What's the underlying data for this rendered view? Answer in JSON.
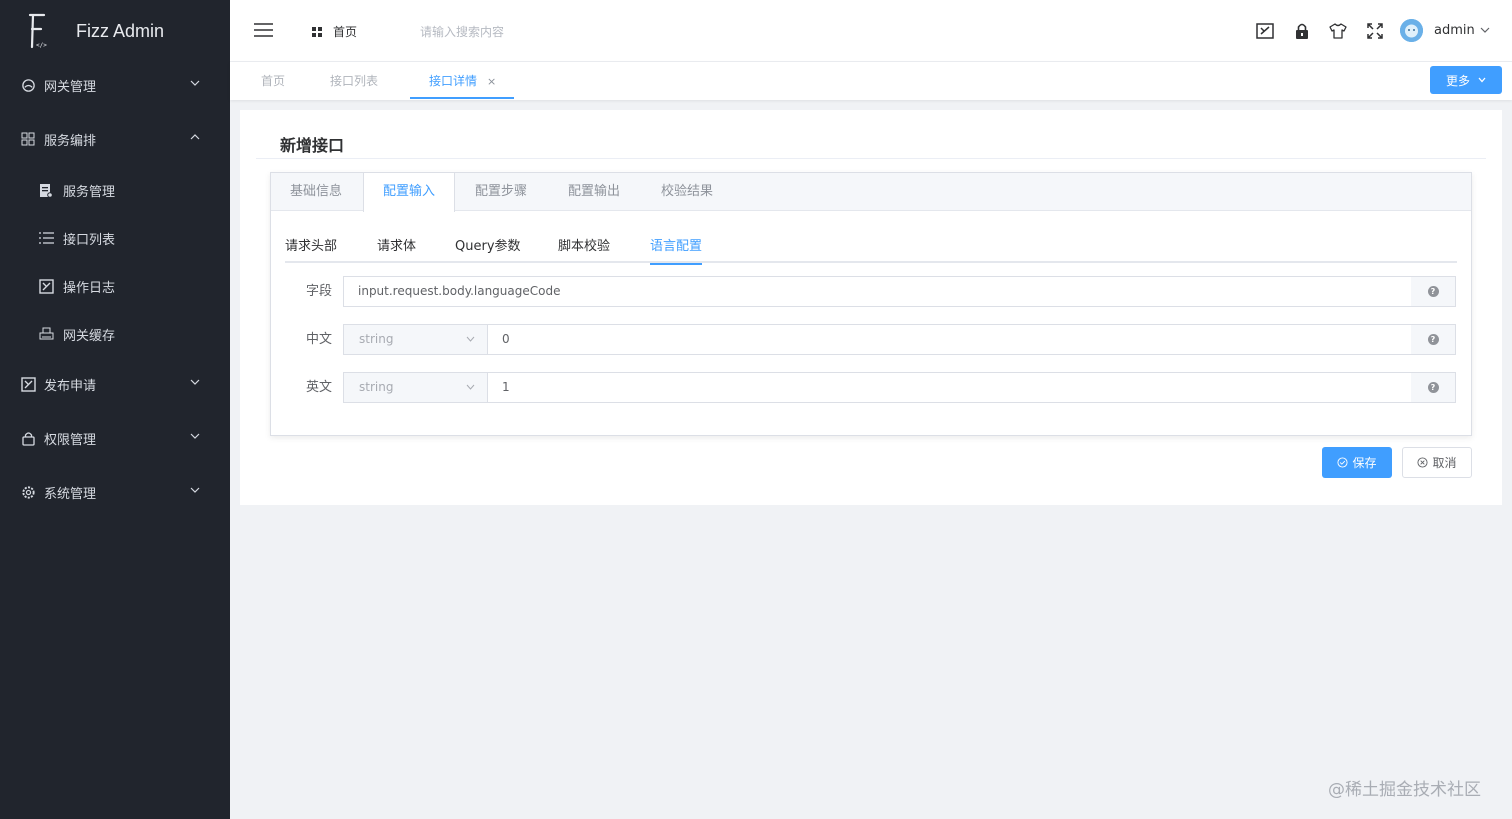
{
  "app": {
    "title": "Fizz Admin"
  },
  "sidebar": {
    "menus": [
      {
        "label": "网关管理",
        "icon": "cloud-icon"
      },
      {
        "label": "服务编排",
        "icon": "grid-icon"
      },
      {
        "label": "发布申请",
        "icon": "edit-icon"
      },
      {
        "label": "权限管理",
        "icon": "lock-icon"
      },
      {
        "label": "系统管理",
        "icon": "gear-icon"
      }
    ],
    "sub_items": [
      {
        "label": "服务管理",
        "icon": "doc-icon"
      },
      {
        "label": "接口列表",
        "icon": "list-icon"
      },
      {
        "label": "操作日志",
        "icon": "log-icon"
      },
      {
        "label": "网关缓存",
        "icon": "printer-icon"
      }
    ]
  },
  "header": {
    "home_label": "首页",
    "search_placeholder": "请输入搜索内容",
    "user_name": "admin"
  },
  "tags": [
    {
      "label": "首页"
    },
    {
      "label": "接口列表"
    },
    {
      "label": "接口详情",
      "close": "×"
    }
  ],
  "more_label": "更多",
  "card": {
    "title": "新增接口",
    "tabs": [
      "基础信息",
      "配置输入",
      "配置步骤",
      "配置输出",
      "校验结果"
    ],
    "active_tab": "配置输入",
    "subtabs": [
      "请求头部",
      "请求体",
      "Query参数",
      "脚本校验",
      "语言配置"
    ],
    "active_subtab": "语言配置",
    "rows": [
      {
        "label": "字段",
        "value": "input.request.body.languageCode"
      },
      {
        "label": "中文",
        "type": "string",
        "value": "0"
      },
      {
        "label": "英文",
        "type": "string",
        "value": "1"
      }
    ],
    "help_symbol": "?",
    "save_label": "保存",
    "cancel_label": "取消"
  },
  "colors": {
    "primary": "#409eff",
    "sidebar_bg": "#21252d"
  },
  "watermark": "@稀土掘金技术社区"
}
